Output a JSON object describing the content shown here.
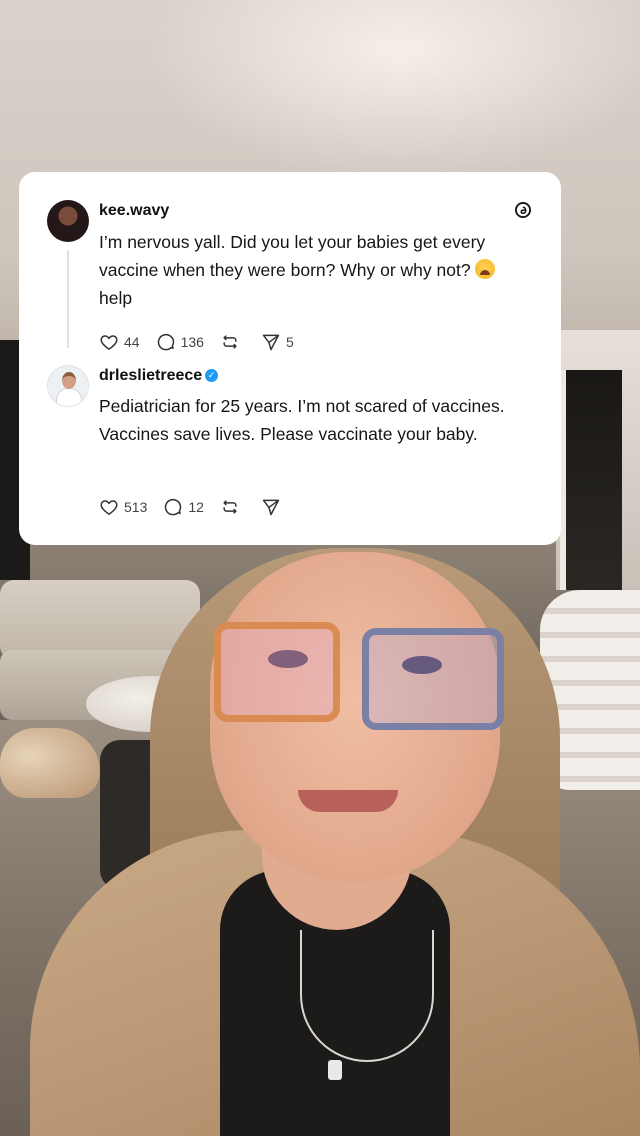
{
  "posts": [
    {
      "username": "kee.wavy",
      "text": "I’m nervous yall. Did you let your babies get every vaccine when they were born? Why or why not?",
      "text_tail": "help",
      "emoji_icon": "crying-face-emoji",
      "likes": "44",
      "replies": "136",
      "reposts": "",
      "shares": "5"
    },
    {
      "username": "drleslietreece",
      "verified": true,
      "text": "Pediatrician for 25 years. I’m not scared of vaccines. Vaccines save lives. Please vaccinate your baby.",
      "likes": "513",
      "replies": "12",
      "reposts": "",
      "shares": ""
    }
  ],
  "icons": {
    "brand": "threads-icon",
    "like": "heart-icon",
    "reply": "comment-icon",
    "repost": "repost-icon",
    "share": "send-icon"
  },
  "colors": {
    "card_background": "#ffffff",
    "text": "#161616",
    "verified": "#1d9bf0"
  }
}
